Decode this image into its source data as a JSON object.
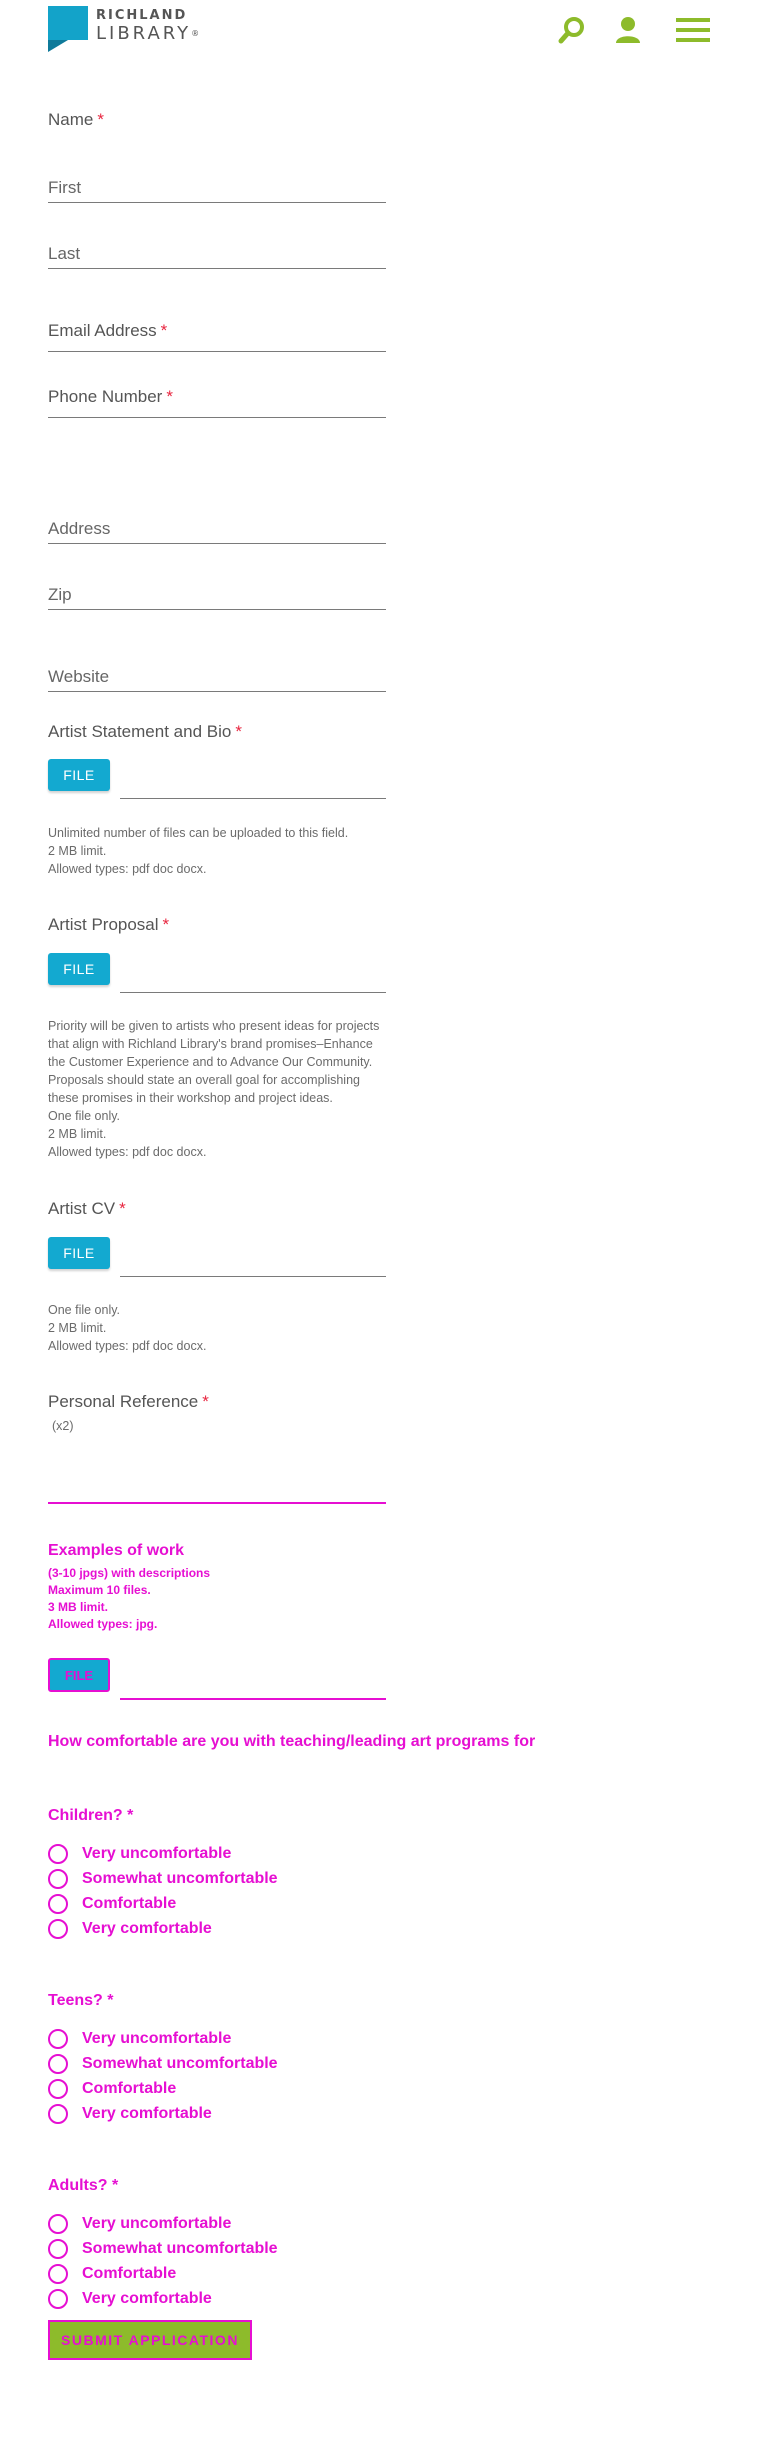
{
  "header": {
    "logo_line1": "RICHLAND",
    "logo_line2": "LIBRARY",
    "logo_mark": "®",
    "icons": [
      "search-icon",
      "user-icon",
      "menu-icon"
    ],
    "accent_color": "#8dbb2b",
    "brand_color": "#13a3c9"
  },
  "form": {
    "name_label": "Name",
    "required_mark": "*",
    "first_placeholder": "First",
    "last_placeholder": "Last",
    "email_label": "Email Address",
    "phone_label": "Phone Number",
    "address_placeholder": "Address",
    "zip_placeholder": "Zip",
    "website_placeholder": "Website",
    "statement": {
      "label": "Artist Statement and Bio",
      "button": "FILE",
      "help": [
        "Unlimited number of files can be uploaded to this field.",
        "2 MB limit.",
        "Allowed types: pdf doc docx."
      ]
    },
    "proposal": {
      "label": "Artist Proposal",
      "button": "FILE",
      "help": [
        "Priority will be given to artists who present ideas for projects that align with Richland Library's brand promises–Enhance the Customer Experience and to Advance Our Community. Proposals should state an overall goal for accomplishing these promises in their workshop and project ideas.",
        "One file only.",
        "2 MB limit.",
        "Allowed types: pdf doc docx."
      ]
    },
    "cv": {
      "label": "Artist CV",
      "button": "FILE",
      "help": [
        "One file only.",
        "2 MB limit.",
        "Allowed types: pdf doc docx."
      ]
    },
    "reference": {
      "label": "Personal Reference",
      "note": "(x2)"
    },
    "examples": {
      "title": "Examples of work",
      "help": [
        "(3-10 jpgs) with descriptions",
        "Maximum 10 files.",
        "3 MB limit.",
        "Allowed types: jpg."
      ],
      "button": "FILE"
    },
    "comfort_question": "How comfortable are you with teaching/leading art programs for",
    "groups": [
      {
        "label": "Children?",
        "options": [
          "Very uncomfortable",
          "Somewhat uncomfortable",
          "Comfortable",
          "Very comfortable"
        ]
      },
      {
        "label": "Teens?",
        "options": [
          "Very uncomfortable",
          "Somewhat uncomfortable",
          "Comfortable",
          "Very comfortable"
        ]
      },
      {
        "label": "Adults?",
        "options": [
          "Very uncomfortable",
          "Somewhat uncomfortable",
          "Comfortable",
          "Very comfortable"
        ]
      }
    ],
    "submit": "SUBMIT APPLICATION"
  }
}
